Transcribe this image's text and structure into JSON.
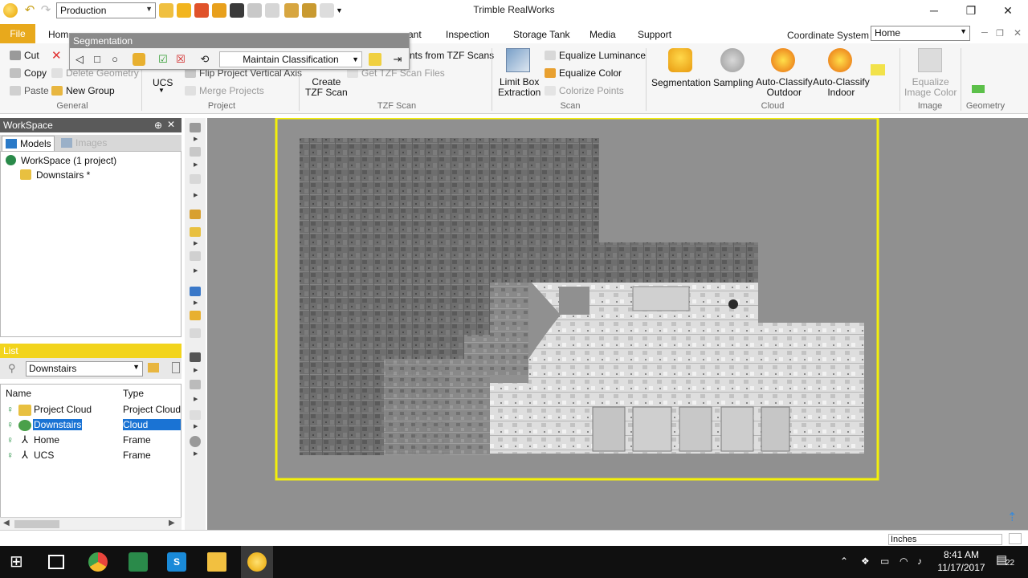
{
  "window": {
    "title": "Trimble RealWorks",
    "project_combo": "Production",
    "controls": {
      "minimize": "─",
      "restore": "❐",
      "close": "✕"
    }
  },
  "tabs": {
    "file": "File",
    "home_partial": "Hom",
    "items": [
      "ant",
      "Inspection",
      "Storage Tank",
      "Media",
      "Support"
    ],
    "coordinate_system_label": "Coordinate System",
    "coordinate_system_value": "Home"
  },
  "ribbon": {
    "general": {
      "label": "General",
      "cut": "Cut",
      "copy": "Copy",
      "paste": "Paste",
      "delete_geometry": "Delete Geometry",
      "new_group": "New Group"
    },
    "project": {
      "label": "Project",
      "ucs": "UCS",
      "flip": "Flip Project Vertical Axis",
      "merge": "Merge Projects"
    },
    "tzf": {
      "label": "TZF Scan",
      "points_from": "nts from TZF Scans",
      "get_files": "Get TZF Scan Files",
      "create_l1": "Create",
      "create_l2": "TZF Scan"
    },
    "scan": {
      "label": "Scan",
      "limit_l1": "Limit Box",
      "limit_l2": "Extraction",
      "eq_luminance": "Equalize Luminance",
      "eq_color": "Equalize Color",
      "colorize": "Colorize Points"
    },
    "cloud": {
      "label": "Cloud",
      "segmentation": "Segmentation",
      "sampling": "Sampling",
      "auto_out_l1": "Auto-Classify",
      "auto_out_l2": "Outdoor",
      "auto_in_l1": "Auto-Classify",
      "auto_in_l2": "Indoor"
    },
    "image": {
      "label": "Image",
      "eq_l1": "Equalize",
      "eq_l2": "Image Color"
    },
    "geometry": {
      "label": "Geometry"
    }
  },
  "segmentation_toolbar": {
    "title": "Segmentation",
    "mode": "Maintain Classification"
  },
  "workspace": {
    "header": "WorkSpace",
    "tab_models": "Models",
    "tab_images": "Images",
    "root": "WorkSpace  (1 project)",
    "child": "Downstairs *"
  },
  "list": {
    "header": "List",
    "filter": "Downstairs",
    "columns": {
      "name": "Name",
      "type": "Type"
    },
    "rows": [
      {
        "name": "Project Cloud",
        "type": "Project Cloud"
      },
      {
        "name": "Downstairs",
        "type": "Cloud"
      },
      {
        "name": "Home",
        "type": "Frame"
      },
      {
        "name": "UCS",
        "type": "Frame"
      }
    ]
  },
  "status": {
    "units": "Inches"
  },
  "taskbar": {
    "time": "8:41 AM",
    "date": "11/17/2017",
    "notifications": "22"
  },
  "colors": {
    "file_tab": "#e8a91c",
    "list_header": "#f2d41c",
    "selection": "#1a73d4",
    "viewport_bg": "#909090",
    "frame_yellow": "#f4f00a"
  }
}
